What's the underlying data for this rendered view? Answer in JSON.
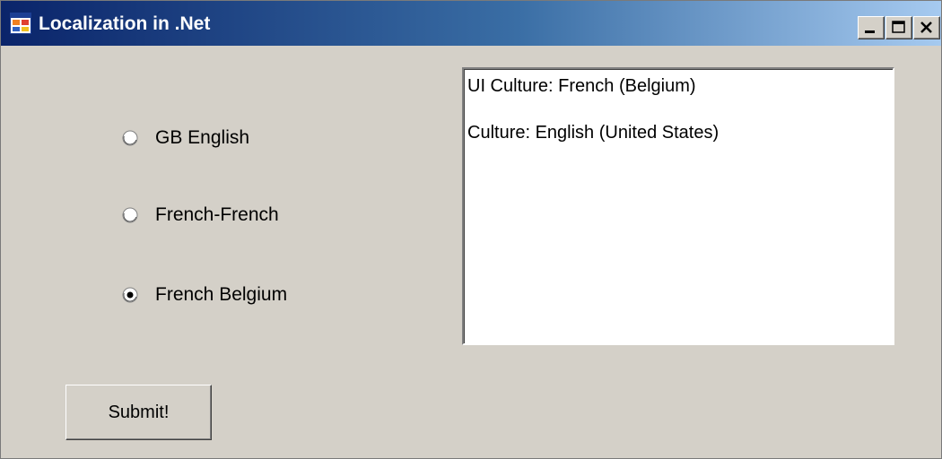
{
  "window": {
    "title": "Localization in .Net",
    "controls": [
      "minimize",
      "maximize",
      "close"
    ]
  },
  "radio_options": [
    {
      "label": "GB English",
      "selected": false
    },
    {
      "label": "French-French",
      "selected": false
    },
    {
      "label": "French Belgium",
      "selected": true
    }
  ],
  "output": {
    "lines": [
      "UI Culture: French (Belgium)",
      "Culture: English (United States)"
    ]
  },
  "submit": {
    "label": "Submit!"
  },
  "colors": {
    "face": "#d4d0c8",
    "title_start": "#0a246a",
    "title_end": "#a6caf0",
    "text": "#000000"
  },
  "icons": {
    "app": "form-window-icon",
    "minimize": "minimize-icon",
    "maximize": "maximize-icon",
    "close": "close-icon",
    "radio_on": "radio-selected-icon",
    "radio_off": "radio-unselected-icon"
  }
}
